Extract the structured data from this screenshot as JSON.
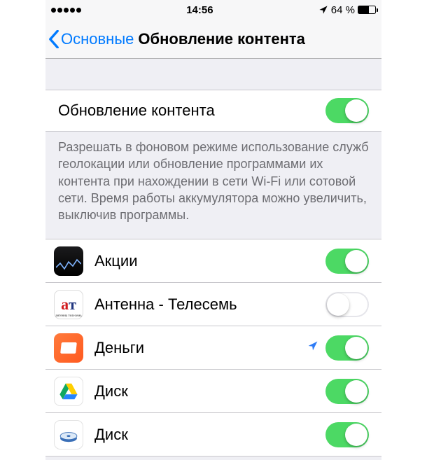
{
  "status": {
    "time": "14:56",
    "battery_text": "64 %",
    "battery_level": 64
  },
  "nav": {
    "back_label": "Основные",
    "title": "Обновление контента"
  },
  "master": {
    "label": "Обновление контента",
    "enabled": true
  },
  "footer": "Разрешать в фоновом режиме использование служб геолокации или обновление программами их контента при нахождении в сети Wi-Fi или сотовой сети. Время работы аккумулятора можно увеличить, выключив программы.",
  "apps": [
    {
      "name": "Акции",
      "icon": "stocks",
      "enabled": true,
      "location": false
    },
    {
      "name": "Антенна - Телесемь",
      "icon": "at",
      "enabled": false,
      "location": false
    },
    {
      "name": "Деньги",
      "icon": "money",
      "enabled": true,
      "location": true
    },
    {
      "name": "Диск",
      "icon": "gdrive",
      "enabled": true,
      "location": false
    },
    {
      "name": "Диск",
      "icon": "idisk",
      "enabled": true,
      "location": false
    }
  ],
  "colors": {
    "tint": "#007aff",
    "toggle_on": "#4cd964"
  }
}
